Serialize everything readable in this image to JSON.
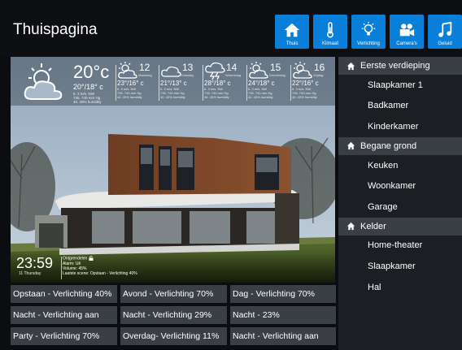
{
  "header": {
    "title": "Thuispagina",
    "nav": [
      {
        "label": "Thuis",
        "icon": "home-icon"
      },
      {
        "label": "Klimaat",
        "icon": "thermometer-icon"
      },
      {
        "label": "Verlichting",
        "icon": "lightbulb-icon"
      },
      {
        "label": "Camera's",
        "icon": "camera-icon"
      },
      {
        "label": "Geluid",
        "icon": "music-icon"
      }
    ]
  },
  "weather": {
    "now": {
      "temp": "20°c",
      "range": "20°/18° c",
      "details": "6. 3 m/s. NW\n735. 740 mm Hg\n40. 40% humidity",
      "icon": "partly-cloudy-icon"
    },
    "days": [
      {
        "day": "12",
        "name": "Maandag",
        "range": "23°/16° c",
        "details": "6. 3 m/s. NW\n735. 740 mm Hg\n40. 40% humidity",
        "icon": "sun-cloud-icon"
      },
      {
        "day": "13",
        "name": "Dinsdag",
        "range": "21°/13° c",
        "details": "6. 3 m/s. NW\n735. 740 mm Hg\n40. 40% humidity",
        "icon": "cloud-icon"
      },
      {
        "day": "14",
        "name": "Woensdag",
        "range": "28°/18° c",
        "details": "6. 3 m/s. NW\n735. 740 mm Hg\n40. 40% humidity",
        "icon": "thunder-cloud-icon"
      },
      {
        "day": "15",
        "name": "Donderdag",
        "range": "24°/18° c",
        "details": "6. 3 m/s. NW\n735. 740 mm Hg\n40. 40% humidity",
        "icon": "sun-cloud-icon"
      },
      {
        "day": "16",
        "name": "Vrijdag",
        "range": "22°/16° c",
        "details": "6. 3 m/s. NW\n735. 740 mm Hg\n40. 40% humidity",
        "icon": "sun-cloud-icon"
      }
    ]
  },
  "status": {
    "time": "23:59",
    "date": "11 Thursday",
    "lines": [
      "Ontgrendelen",
      "Alarm: Uit",
      "Volume: 45%",
      "Laatste scene: Opstaan - Verlichting 40%"
    ]
  },
  "scenes": [
    [
      "Opstaan - Verlichting 40%",
      "Avond - Verlichting 70%",
      "Dag - Verlichting 70%"
    ],
    [
      "Nacht - Verlichting aan",
      "Nacht - Verlichting 29%",
      "Nacht - 23%"
    ],
    [
      "Party - Verlichting 70%",
      "Overdag- Verlichting 11%",
      "Nacht - Verlichting aan"
    ]
  ],
  "sidebar": {
    "sections": [
      {
        "label": "Eerste verdieping",
        "items": [
          "Slaapkamer 1",
          "Badkamer",
          "Kinderkamer"
        ]
      },
      {
        "label": "Begane grond",
        "items": [
          "Keuken",
          "Woonkamer",
          "Garage"
        ]
      },
      {
        "label": "Kelder",
        "items": [
          "Home-theater",
          "Slaapkamer",
          "Hal"
        ]
      }
    ]
  },
  "colors": {
    "accent": "#0a7fd9",
    "button": "#3a3f45",
    "sidebar": "#1b1e23",
    "background": "#0b0d10"
  }
}
